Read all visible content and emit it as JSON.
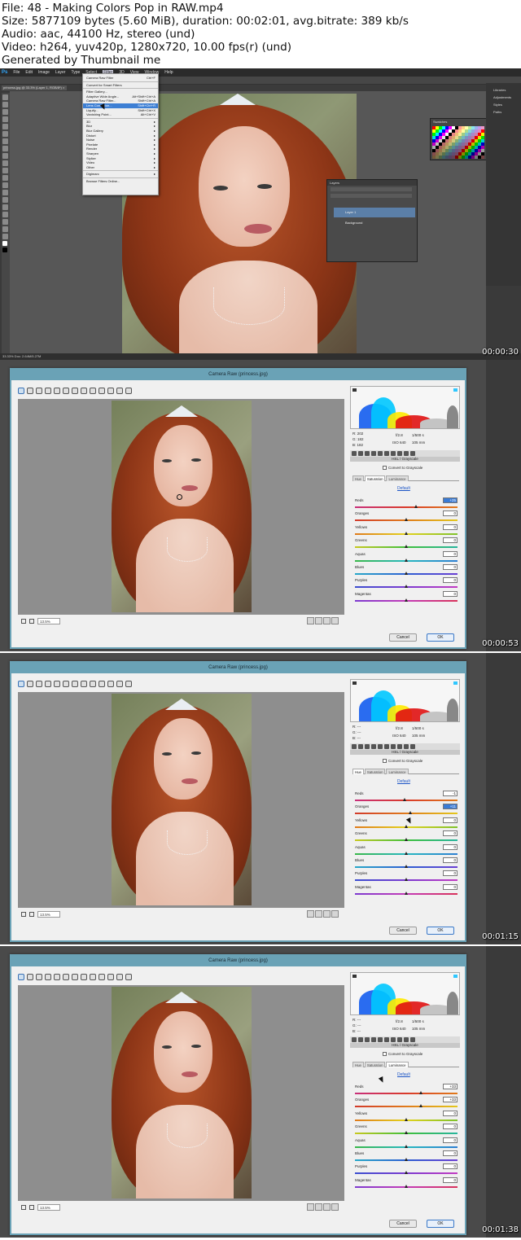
{
  "header": {
    "file": "File: 48 - Making Colors Pop in RAW.mp4",
    "size": "Size: 5877109 bytes (5.60 MiB), duration: 00:02:01, avg.bitrate: 389 kb/s",
    "audio": "Audio: aac, 44100 Hz, stereo (und)",
    "video": "Video: h264, yuv420p, 1280x720, 10.00 fps(r) (und)",
    "generator": "Generated by Thumbnail me"
  },
  "frames": [
    {
      "timestamp": "00:00:30"
    },
    {
      "timestamp": "00:00:53"
    },
    {
      "timestamp": "00:01:15"
    },
    {
      "timestamp": "00:01:38"
    }
  ],
  "photoshop": {
    "menus": [
      "Ps",
      "File",
      "Edit",
      "Image",
      "Layer",
      "Type",
      "Select",
      "Filter",
      "3D",
      "View",
      "Window",
      "Help"
    ],
    "doc_tab": "princess.jpg @ 33.3% (Layer 1, RGB/8*) ×",
    "filter_menu": [
      {
        "label": "Camera Raw Filter",
        "shortcut": "Ctrl+F"
      },
      {
        "sep": true
      },
      {
        "label": "Convert for Smart Filters",
        "shortcut": ""
      },
      {
        "sep": true
      },
      {
        "label": "Filter Gallery...",
        "shortcut": ""
      },
      {
        "label": "Adaptive Wide Angle...",
        "shortcut": "Alt+Shift+Ctrl+A"
      },
      {
        "label": "Camera Raw Filter...",
        "shortcut": "Shift+Ctrl+A"
      },
      {
        "label": "Lens Correction...",
        "shortcut": "Shift+Ctrl+R",
        "hl": true
      },
      {
        "label": "Liquify...",
        "shortcut": "Shift+Ctrl+X"
      },
      {
        "label": "Vanishing Point...",
        "shortcut": "Alt+Ctrl+V"
      },
      {
        "sep": true
      },
      {
        "label": "3D",
        "shortcut": "▸"
      },
      {
        "label": "Blur",
        "shortcut": "▸"
      },
      {
        "label": "Blur Gallery",
        "shortcut": "▸"
      },
      {
        "label": "Distort",
        "shortcut": "▸"
      },
      {
        "label": "Noise",
        "shortcut": "▸"
      },
      {
        "label": "Pixelate",
        "shortcut": "▸"
      },
      {
        "label": "Render",
        "shortcut": "▸"
      },
      {
        "label": "Sharpen",
        "shortcut": "▸"
      },
      {
        "label": "Stylize",
        "shortcut": "▸"
      },
      {
        "label": "Video",
        "shortcut": "▸"
      },
      {
        "label": "Other",
        "shortcut": "▸"
      },
      {
        "sep": true
      },
      {
        "label": "Digimarc",
        "shortcut": "▸"
      },
      {
        "sep": true
      },
      {
        "label": "Browse Filters Online...",
        "shortcut": ""
      }
    ],
    "layers_title": "Layers",
    "layers": [
      "Layer 1",
      "Background"
    ],
    "right_panel": [
      "Libraries",
      "Adjustments",
      "Styles",
      "Paths"
    ],
    "swatches_title": "Swatches",
    "status": "33.33%    Doc: 2.64M/5.27M"
  },
  "camera_raw": {
    "title": "Camera Raw (princess.jpg)",
    "zoom": "13.5%",
    "exif": {
      "aperture": "f/2.8",
      "shutter": "1/500 s",
      "iso": "ISO 640",
      "lens": "105 mm"
    },
    "rgb_frame2": {
      "r": "R: 202",
      "g": "G: 182",
      "b": "B: 182"
    },
    "rgb_blank": {
      "r": "R:  ---",
      "g": "G:  ---",
      "b": "B:  ---"
    },
    "panel_title": "HSL / Grayscale",
    "convert_gray": "Convert to Grayscale",
    "tabs": [
      "Hue",
      "Saturation",
      "Luminance"
    ],
    "default": "Default",
    "labels": [
      "Reds",
      "Oranges",
      "Yellows",
      "Greens",
      "Aquas",
      "Blues",
      "Purples",
      "Magentas"
    ],
    "cancel": "Cancel",
    "ok": "OK",
    "saturation_values": [
      "+25",
      "0",
      "0",
      "0",
      "0",
      "0",
      "0",
      "0"
    ],
    "hue_values": [
      "-1",
      "+11",
      "0",
      "0",
      "0",
      "0",
      "0",
      "0"
    ],
    "luminance_values": [
      "+33",
      "+33",
      "0",
      "0",
      "0",
      "0",
      "0",
      "0"
    ]
  },
  "colors": {
    "dialog_border": "#6aa2b6",
    "ps_bg": "#3a3a3a",
    "link": "#1c55c6"
  }
}
